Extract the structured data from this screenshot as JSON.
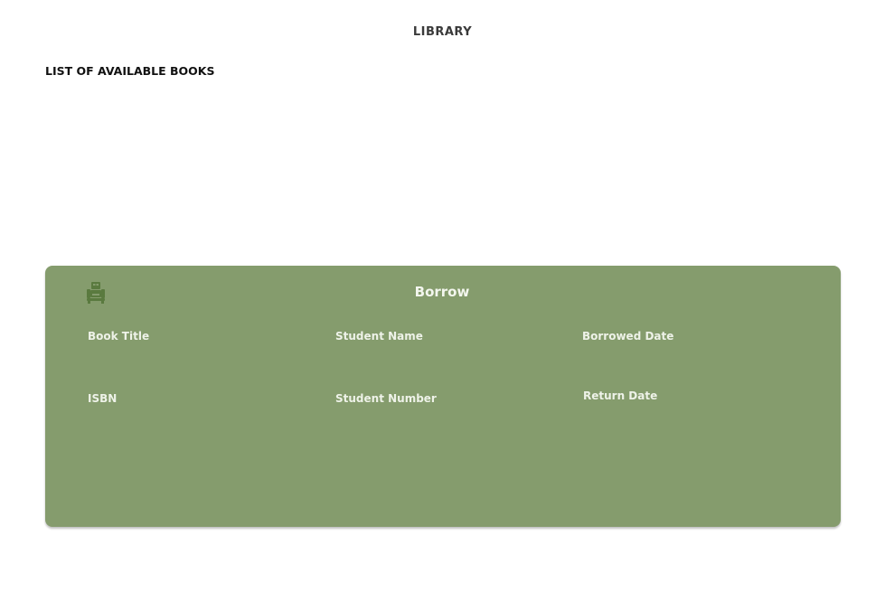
{
  "header": {
    "title": "LIBRARY"
  },
  "books_section": {
    "heading": "LIST OF AVAILABLE BOOKS"
  },
  "borrow_panel": {
    "title": "Borrow",
    "icon": "reader-icon",
    "fields": {
      "book_title": "Book Title",
      "student_name": "Student Name",
      "borrowed_date": "Borrowed Date",
      "isbn": "ISBN",
      "student_number": "Student Number",
      "return_date": "Return Date"
    },
    "colors": {
      "panel_background": "#859c6d",
      "icon": "#5a7a3f",
      "label_text": "#eef2e8"
    }
  }
}
